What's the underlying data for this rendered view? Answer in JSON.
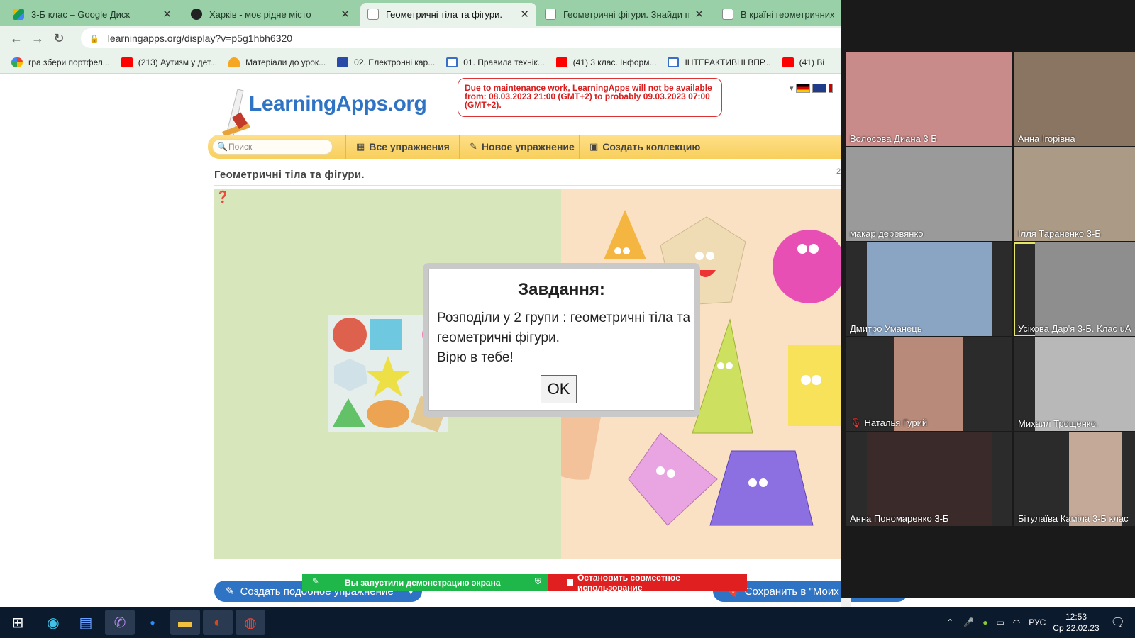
{
  "browser": {
    "tabs": [
      {
        "label": "3-Б клас – Google Диск",
        "icon": "google-drive-icon",
        "active": false
      },
      {
        "label": "Харків - моє рідне місто",
        "icon": "app-icon",
        "active": false
      },
      {
        "label": "Геометричні тіла та фігури.",
        "icon": "learningapps-icon",
        "active": true
      },
      {
        "label": "Геометричні фігури. Знайди па",
        "icon": "learningapps-icon",
        "active": false
      },
      {
        "label": "В країні геометричних фі",
        "icon": "learningapps-icon",
        "active": false
      }
    ],
    "url": "learningapps.org/display?v=p5g1hbh6320",
    "bookmarks": [
      {
        "label": "гра збери портфел...",
        "icon": "google-icon"
      },
      {
        "label": "(213) Аутизм у дет...",
        "icon": "youtube-icon"
      },
      {
        "label": "Матеріали до урок...",
        "icon": "bell-icon"
      },
      {
        "label": "02. Електронні кар...",
        "icon": "grid-icon"
      },
      {
        "label": "01. Правила технік...",
        "icon": "doc-icon"
      },
      {
        "label": "(41) 3 клас. Інформ...",
        "icon": "youtube-icon"
      },
      {
        "label": "ІНТЕРАКТИВНІ ВПР...",
        "icon": "doc-icon"
      },
      {
        "label": "(41) Ві",
        "icon": "youtube-icon"
      }
    ]
  },
  "site": {
    "logo": "LearningApps.org",
    "notice": "Due to maintenance work, LearningApps will not be available from: 08.03.2023 21:00 (GMT+2) to probably 09.03.2023 07:00 (GMT+2).",
    "search_placeholder": "Поиск",
    "menu": [
      "Все упражнения",
      "Новое упражнение",
      "Создать коллекцию"
    ],
    "page_title": "Геометричні тіла та фігури.",
    "page_num": "2"
  },
  "dialog": {
    "title": "Завдання:",
    "line1": "Розподіли у 2 групи : геометричні тіла та геометричні фігури.",
    "line2": "Вірю в тебе!",
    "ok": "OK"
  },
  "bottom": {
    "similar": "Создать подобное упражнение",
    "save": "Сохранить в \"Моих уп",
    "share_started": "Вы запустили демонстрацию экрана",
    "share_stop": "Остановить совместное использование"
  },
  "zoom": {
    "participants": [
      {
        "name": "Волосова Диана 3 Б",
        "color": "#c98a8a"
      },
      {
        "name": "Анна Ігорівна",
        "color": "#8a7462"
      },
      {
        "name": "макар  деревянко",
        "color": "#9a9a9a"
      },
      {
        "name": "Ілля Тараненко 3-Б",
        "color": "#aa9a86"
      },
      {
        "name": "Дмитро Уманець",
        "color": "#8aa4c4"
      },
      {
        "name": "Усікова Дар'я 3-Б. Клас uA",
        "color": "#8e8e8e",
        "speaking": true
      },
      {
        "name": "Наталья Гурий",
        "color": "#b88a7a",
        "muted": true
      },
      {
        "name": "Михаил Трощенко.",
        "color": "#b8b8b8"
      },
      {
        "name": "Анна Пономаренко 3-Б",
        "color": "#3a2a2a"
      },
      {
        "name": "Бітулаїва Каміла 3-Б клас",
        "color": "#c4a898"
      }
    ]
  },
  "taskbar": {
    "lang": "РУС",
    "time": "12:53",
    "date": "Ср 22.02.23"
  }
}
